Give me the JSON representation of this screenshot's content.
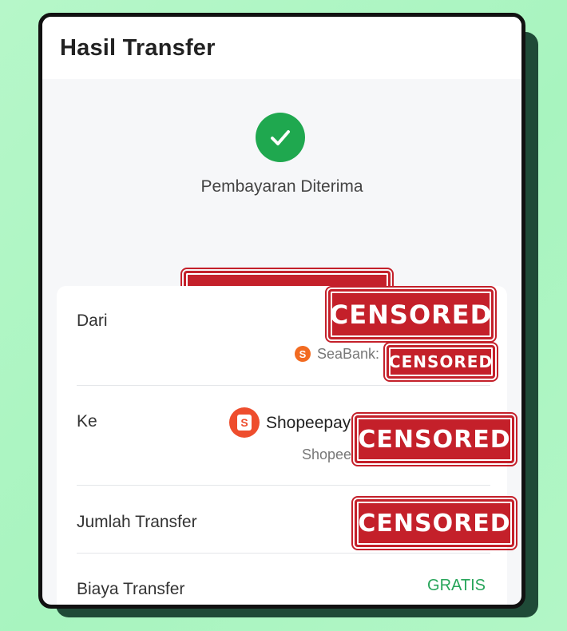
{
  "header": {
    "title": "Hasil Transfer"
  },
  "status": {
    "text": "Pembayaran Diterima",
    "icon": "check-circle-icon",
    "color": "#1fa84f"
  },
  "redaction": {
    "label": "CENSORED",
    "color": "#c4202a"
  },
  "details": {
    "from": {
      "label": "Dari",
      "bank_name": "SeaBank:"
    },
    "to": {
      "label": "Ke",
      "wallet_name": "Shopeepay",
      "sub_label": "Shopee"
    },
    "amount": {
      "label": "Jumlah Transfer"
    },
    "fee": {
      "label": "Biaya Transfer",
      "value": "GRATIS",
      "value_color": "#27a55a"
    }
  }
}
